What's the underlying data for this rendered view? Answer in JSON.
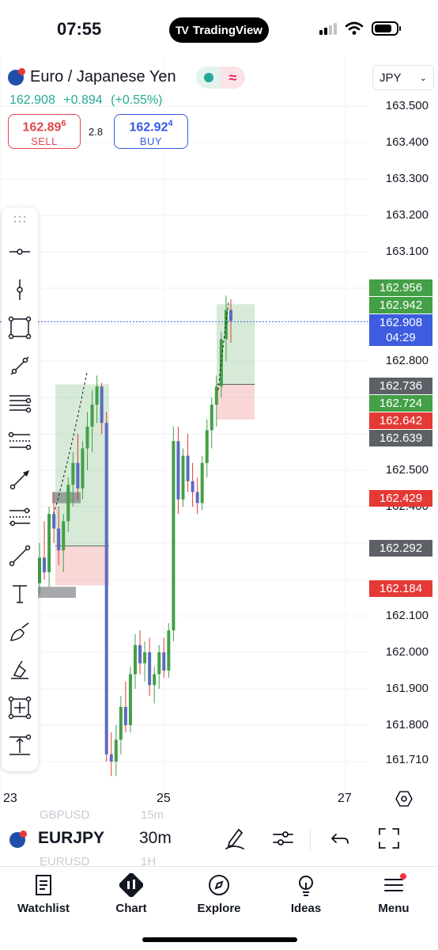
{
  "status_bar": {
    "time": "07:55",
    "app_pill": "TradingView",
    "app_pill_logo": "TV"
  },
  "header": {
    "symbol_full": "Euro / Japanese Yen",
    "last_price": "162.908",
    "change": "+0.894",
    "change_pct": "(+0.55%)",
    "market_status_icon": "market-open-dot",
    "sell": {
      "price_main": "162.89",
      "price_sup": "6",
      "label": "SELL"
    },
    "spread": "2.8",
    "buy": {
      "price_main": "162.92",
      "price_sup": "4",
      "label": "BUY"
    },
    "currency": "JPY"
  },
  "price_axis": {
    "ticks": [
      "163.500",
      "163.400",
      "163.300",
      "163.200",
      "163.100",
      "162.800",
      "162.500",
      "162.400",
      "162.100",
      "162.000",
      "161.900",
      "161.800",
      "161.710"
    ],
    "badges": [
      {
        "value": "162.956",
        "color": "#43a047"
      },
      {
        "value": "162.942",
        "color": "#43a047"
      },
      {
        "value": "162.908",
        "sub": "04:29",
        "color": "#3d5ce0"
      },
      {
        "value": "162.736",
        "color": "#5d6067"
      },
      {
        "value": "162.724",
        "color": "#43a047"
      },
      {
        "value": "162.642",
        "color": "#e53935"
      },
      {
        "value": "162.639",
        "color": "#5d6067"
      },
      {
        "value": "162.429",
        "color": "#e53935"
      },
      {
        "value": "162.292",
        "color": "#5d6067"
      },
      {
        "value": "162.184",
        "color": "#e53935"
      }
    ]
  },
  "time_axis": {
    "labels": [
      "23",
      "25",
      "27"
    ]
  },
  "drawing_tools": [
    "horizontal-ray-icon",
    "vertical-line-icon",
    "rectangle-icon",
    "trend-line-icon",
    "fib-retracement-icon",
    "pitchfork-icon",
    "arrow-icon",
    "gann-fan-icon",
    "trend-angle-icon",
    "text-icon",
    "brush-icon",
    "highlighter-icon",
    "measure-icon",
    "price-range-icon"
  ],
  "symbol_bar": {
    "symbol": "EURJPY",
    "timeframe": "30m",
    "ghost_prev_symbol": "GBPUSD",
    "ghost_prev_tf": "15m",
    "ghost_next_symbol": "EURUSD",
    "ghost_next_tf": "1H",
    "icons": [
      "drawing-pen-icon",
      "indicators-icon",
      "undo-icon",
      "fullscreen-icon"
    ]
  },
  "bottom_nav": [
    {
      "label": "Watchlist",
      "icon": "watchlist-icon"
    },
    {
      "label": "Chart",
      "icon": "chart-icon"
    },
    {
      "label": "Explore",
      "icon": "compass-icon"
    },
    {
      "label": "Ideas",
      "icon": "lightbulb-icon"
    },
    {
      "label": "Menu",
      "icon": "menu-icon"
    }
  ],
  "colors": {
    "up": "#43a047",
    "down": "#e53935",
    "accent_blue": "#3d5ce0",
    "price_green": "#22ab94"
  },
  "chart_data": {
    "type": "candlestick",
    "symbol": "EURJPY",
    "timeframe": "30m",
    "ylim": [
      161.69,
      163.55
    ],
    "x_tick_labels": [
      "23",
      "25",
      "27"
    ],
    "last_price": 162.908,
    "candles": [
      [
        162.19,
        162.3,
        162.16,
        162.26
      ],
      [
        162.26,
        162.36,
        162.2,
        162.22
      ],
      [
        162.22,
        162.4,
        162.18,
        162.38
      ],
      [
        162.38,
        162.44,
        162.3,
        162.34
      ],
      [
        162.34,
        162.4,
        162.24,
        162.28
      ],
      [
        162.28,
        162.38,
        162.22,
        162.36
      ],
      [
        162.36,
        162.48,
        162.33,
        162.46
      ],
      [
        162.46,
        162.55,
        162.4,
        162.52
      ],
      [
        162.52,
        162.6,
        162.42,
        162.45
      ],
      [
        162.45,
        162.58,
        162.42,
        162.56
      ],
      [
        162.56,
        162.66,
        162.5,
        162.62
      ],
      [
        162.62,
        162.72,
        162.55,
        162.68
      ],
      [
        162.68,
        162.76,
        162.63,
        162.73
      ],
      [
        162.73,
        162.74,
        162.6,
        162.63
      ],
      [
        162.63,
        162.66,
        161.7,
        161.72
      ],
      [
        161.72,
        161.78,
        161.66,
        161.7
      ],
      [
        161.7,
        161.8,
        161.66,
        161.76
      ],
      [
        161.76,
        161.88,
        161.72,
        161.85
      ],
      [
        161.85,
        161.92,
        161.78,
        161.8
      ],
      [
        161.8,
        161.96,
        161.78,
        161.94
      ],
      [
        161.94,
        162.05,
        161.9,
        162.02
      ],
      [
        162.02,
        162.06,
        161.94,
        161.97
      ],
      [
        161.97,
        162.03,
        161.92,
        162.0
      ],
      [
        162.0,
        162.04,
        161.88,
        161.91
      ],
      [
        161.91,
        161.96,
        161.86,
        161.94
      ],
      [
        161.94,
        162.02,
        161.9,
        162.0
      ],
      [
        162.0,
        162.04,
        161.93,
        161.95
      ],
      [
        161.95,
        162.08,
        161.93,
        162.06
      ],
      [
        162.06,
        162.62,
        162.03,
        162.58
      ],
      [
        162.58,
        162.62,
        162.38,
        162.42
      ],
      [
        162.42,
        162.56,
        162.4,
        162.54
      ],
      [
        162.54,
        162.6,
        162.44,
        162.47
      ],
      [
        162.47,
        162.52,
        162.4,
        162.44
      ],
      [
        162.44,
        162.48,
        162.38,
        162.41
      ],
      [
        162.41,
        162.54,
        162.39,
        162.52
      ],
      [
        162.52,
        162.64,
        162.48,
        162.61
      ],
      [
        162.61,
        162.7,
        162.56,
        162.68
      ],
      [
        162.68,
        162.76,
        162.62,
        162.73
      ],
      [
        162.73,
        162.88,
        162.7,
        162.86
      ],
      [
        162.86,
        162.98,
        162.8,
        162.94
      ],
      [
        162.94,
        162.97,
        162.85,
        162.91
      ]
    ],
    "zones": [
      {
        "kind": "long-position",
        "entry": 162.292,
        "target": 162.736,
        "stop": 162.184
      },
      {
        "kind": "long-position",
        "entry": 162.736,
        "target": 162.956,
        "stop": 162.639
      }
    ]
  }
}
